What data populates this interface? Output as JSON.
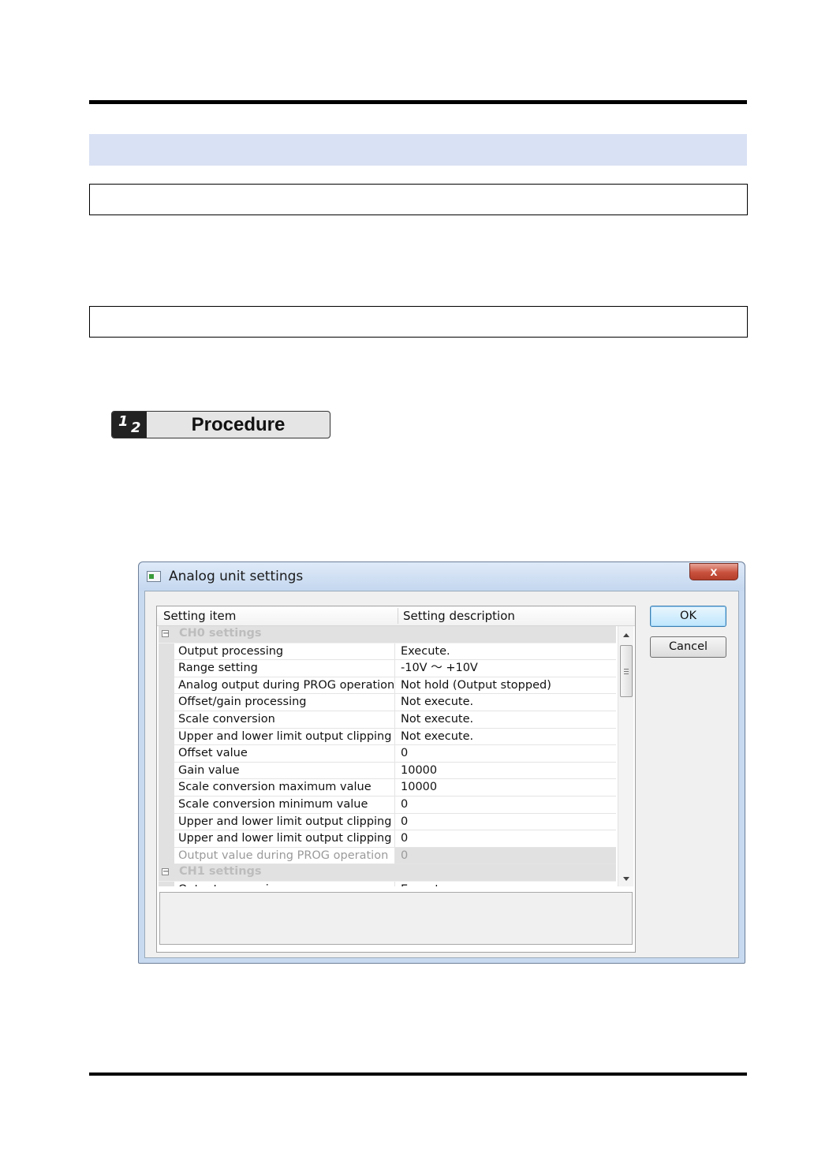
{
  "procedure": {
    "num1": "1",
    "num2": "2",
    "label": "Procedure"
  },
  "dialog": {
    "title": "Analog unit settings",
    "close_label": "x",
    "headers": {
      "item": "Setting item",
      "description": "Setting description"
    },
    "groups": [
      {
        "label": "CH0 settings",
        "toggle": "−",
        "rows": [
          {
            "name": "Output processing",
            "value": "Execute."
          },
          {
            "name": "Range setting",
            "value": "-10V 〜 +10V"
          },
          {
            "name": "Analog output during PROG operation",
            "value": "Not hold (Output stopped)"
          },
          {
            "name": "Offset/gain processing",
            "value": "Not execute."
          },
          {
            "name": "Scale conversion",
            "value": "Not execute."
          },
          {
            "name": "Upper and lower limit output clipping",
            "value": "Not execute."
          },
          {
            "name": "Offset value",
            "value": "0"
          },
          {
            "name": "Gain value",
            "value": "10000"
          },
          {
            "name": "Scale conversion maximum value",
            "value": "10000"
          },
          {
            "name": "Scale conversion minimum value",
            "value": "0"
          },
          {
            "name": "Upper and lower limit output clipping ...",
            "value": "0"
          },
          {
            "name": "Upper and lower limit output clipping ...",
            "value": "0"
          },
          {
            "name": "Output value during PROG operation",
            "value": "0",
            "disabled": true
          }
        ]
      },
      {
        "label": "CH1 settings",
        "toggle": "−",
        "rows": [
          {
            "name": "Output processing",
            "value": "Execute."
          }
        ]
      }
    ],
    "buttons": {
      "ok": "OK",
      "cancel": "Cancel"
    },
    "colors": {
      "title_bg": "#c8daf0",
      "close_red": "#c8513d",
      "group_bg": "#e1e1e1",
      "band": "#d9e1f4"
    }
  }
}
